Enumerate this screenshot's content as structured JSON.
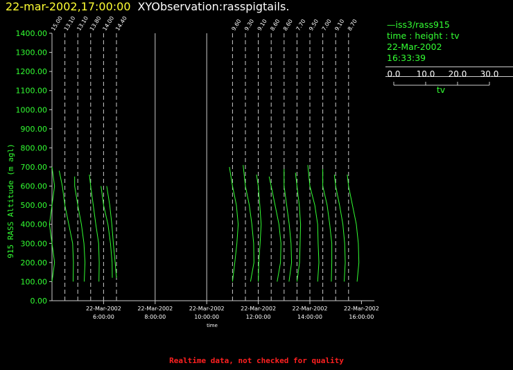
{
  "header": {
    "datetime": "22-mar-2002,17:00:00",
    "title": "XYObservation:rasspigtails."
  },
  "legend": {
    "series_label": "iss3/rass915",
    "desc": "time : height : tv",
    "date": "22-Mar-2002",
    "time": "16:33:39",
    "scale_ticks": [
      "0.0",
      "10.0",
      "20.0",
      "30.0"
    ],
    "scale_label": "tv"
  },
  "footer": "Realtime data, not checked for quality",
  "colors": {
    "data": "#33ff33",
    "axis": "#cccccc",
    "header_date": "#ffff33",
    "footer": "#ff2020"
  },
  "chart_data": {
    "type": "line",
    "ylabel": "915 RASS Altitude (m agl)",
    "xlabel": "time",
    "ylim": [
      0,
      1400
    ],
    "y_ticks": [
      "0.00",
      "100.00",
      "200.00",
      "300.00",
      "400.00",
      "500.00",
      "600.00",
      "700.00",
      "800.00",
      "900.00",
      "1000.00",
      "1100.00",
      "1200.00",
      "1300.00",
      "1400.00"
    ],
    "x_range_hours": [
      4.0,
      17.0
    ],
    "x_ticks": [
      {
        "hour": 6,
        "date": "22-Mar-2002",
        "time": "6:00:00"
      },
      {
        "hour": 8,
        "date": "22-Mar-2002",
        "time": "8:00:00"
      },
      {
        "hour": 10,
        "date": "22-Mar-2002",
        "time": "10:00:00"
      },
      {
        "hour": 12,
        "date": "22-Mar-2002",
        "time": "12:00:00"
      },
      {
        "hour": 14,
        "date": "22-Mar-2002",
        "time": "14:00:00"
      },
      {
        "hour": 16,
        "date": "22-Mar-2002",
        "time": "16:00:00"
      }
    ],
    "profiles": [
      {
        "hour": 4.0,
        "label": "15.00",
        "dx": [
          0.0,
          0.1,
          0.0,
          -0.1,
          0.0,
          0.1,
          0.0
        ],
        "h": [
          100,
          200,
          300,
          400,
          500,
          600,
          700
        ]
      },
      {
        "hour": 4.5,
        "label": "13.10",
        "dx": [
          0.32,
          0.33,
          0.3,
          0.15,
          0.0,
          -0.1,
          -0.22
        ],
        "h": [
          100,
          200,
          300,
          400,
          500,
          600,
          680
        ]
      },
      {
        "hour": 5.0,
        "label": "13.10",
        "dx": [
          0.25,
          0.28,
          0.24,
          0.14,
          0.0,
          -0.12,
          -0.12
        ],
        "h": [
          100,
          200,
          300,
          400,
          500,
          600,
          650
        ]
      },
      {
        "hour": 5.5,
        "label": "13.80",
        "dx": [
          0.32,
          0.33,
          0.31,
          0.2,
          0.1,
          0.0,
          -0.05
        ],
        "h": [
          100,
          200,
          300,
          400,
          500,
          600,
          660
        ]
      },
      {
        "hour": 6.0,
        "label": "14.00",
        "dx": [
          0.34,
          0.33,
          0.27,
          0.17,
          0.0,
          -0.1
        ],
        "h": [
          120,
          200,
          300,
          400,
          500,
          600
        ]
      },
      {
        "hour": 6.5,
        "label": "14.40",
        "dx": [
          0.0,
          -0.05,
          -0.12,
          -0.18,
          -0.26,
          -0.38
        ],
        "h": [
          120,
          200,
          300,
          400,
          500,
          600
        ]
      },
      {
        "hour": 11.0,
        "label": "9.60",
        "dx": [
          0.0,
          0.09,
          0.17,
          0.22,
          0.15,
          0.0,
          -0.12
        ],
        "h": [
          100,
          200,
          300,
          400,
          500,
          600,
          700
        ]
      },
      {
        "hour": 11.5,
        "label": "9.30",
        "dx": [
          0.2,
          0.33,
          0.32,
          0.25,
          0.15,
          0.0,
          -0.09
        ],
        "h": [
          100,
          200,
          300,
          400,
          500,
          600,
          710
        ]
      },
      {
        "hour": 12.0,
        "label": "9.10",
        "dx": [
          0.0,
          0.02,
          0.07,
          0.11,
          0.06,
          0.0,
          -0.07
        ],
        "h": [
          100,
          200,
          300,
          400,
          500,
          600,
          660
        ]
      },
      {
        "hour": 12.5,
        "label": "8.60",
        "dx": [
          0.23,
          0.36,
          0.38,
          0.3,
          0.15,
          0.0,
          -0.08
        ],
        "h": [
          100,
          200,
          300,
          400,
          500,
          600,
          650
        ]
      },
      {
        "hour": 13.0,
        "label": "8.60",
        "dx": [
          0.19,
          0.29,
          0.27,
          0.2,
          0.1,
          0.0,
          0.0
        ],
        "h": [
          100,
          200,
          300,
          400,
          500,
          600,
          690
        ]
      },
      {
        "hour": 13.5,
        "label": "7.70",
        "dx": [
          0.0,
          0.1,
          0.12,
          0.14,
          0.09,
          0.0,
          -0.06
        ],
        "h": [
          100,
          200,
          300,
          400,
          500,
          600,
          670
        ]
      },
      {
        "hour": 14.0,
        "label": "9.50",
        "dx": [
          0.3,
          0.35,
          0.32,
          0.3,
          0.19,
          0.0,
          -0.08
        ],
        "h": [
          100,
          200,
          300,
          400,
          500,
          600,
          710
        ]
      },
      {
        "hour": 14.5,
        "label": "7.00",
        "dx": [
          0.33,
          0.35,
          0.35,
          0.27,
          0.17,
          0.0,
          0.0
        ],
        "h": [
          100,
          200,
          300,
          400,
          500,
          600,
          690
        ]
      },
      {
        "hour": 15.0,
        "label": "9.10",
        "dx": [
          0.33,
          0.37,
          0.35,
          0.28,
          0.15,
          0.0,
          -0.05
        ],
        "h": [
          100,
          200,
          300,
          400,
          500,
          600,
          660
        ]
      },
      {
        "hour": 15.5,
        "label": "8.70",
        "dx": [
          0.33,
          0.4,
          0.38,
          0.3,
          0.15,
          0.0,
          -0.05
        ],
        "h": [
          100,
          200,
          300,
          400,
          500,
          600,
          660
        ]
      }
    ]
  }
}
